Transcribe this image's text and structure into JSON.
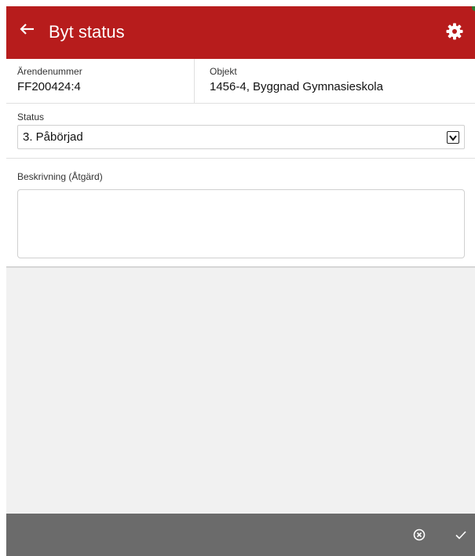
{
  "header": {
    "title": "Byt status",
    "back_icon": "arrow-left-icon",
    "settings_icon": "gear-icon",
    "background": "#b71c1c"
  },
  "info": {
    "case_number_label": "Ärendenummer",
    "case_number_value": "FF200424:4",
    "object_label": "Objekt",
    "object_value": "1456-4, Byggnad Gymnasieskola"
  },
  "status": {
    "label": "Status",
    "selected_value": "3. Påbörjad"
  },
  "description": {
    "label": "Beskrivning (Åtgärd)",
    "value": ""
  },
  "footer": {
    "cancel_icon": "circle-x-icon",
    "confirm_icon": "checkmark-icon",
    "background": "#6b6b6b"
  }
}
